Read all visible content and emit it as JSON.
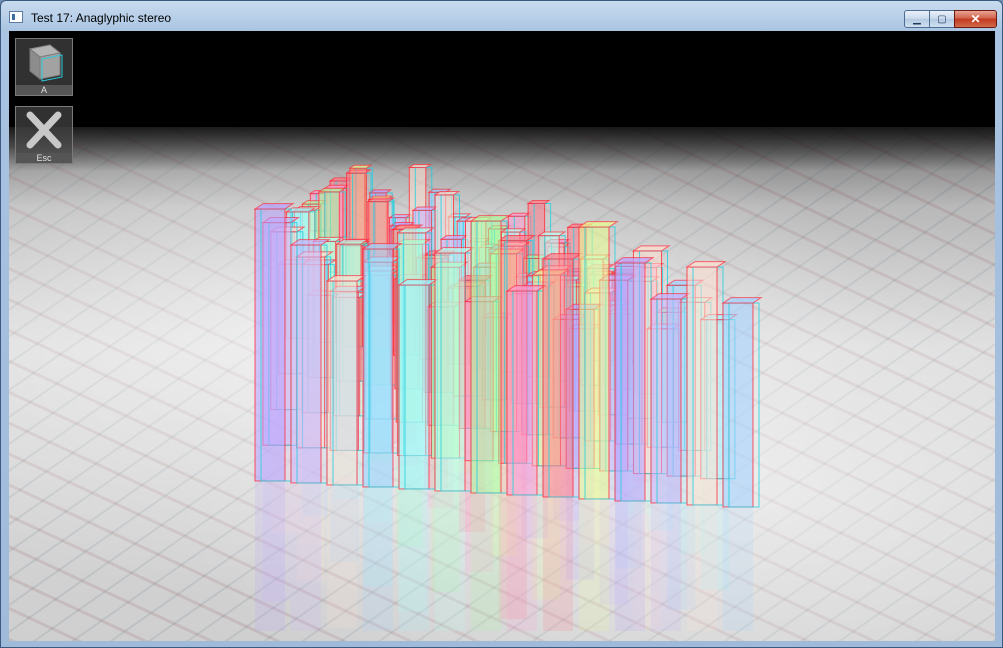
{
  "window": {
    "title": "Test 17: Anaglyphic stereo",
    "controls": {
      "minimize": "▁",
      "maximize": "▢",
      "close": "✕"
    }
  },
  "toolbar": {
    "buttons": [
      {
        "key": "A",
        "icon": "cube-icon"
      },
      {
        "key": "Esc",
        "icon": "close-x-icon"
      }
    ]
  },
  "scene": {
    "bar_palette": [
      "#ff9ad2",
      "#b7a0ff",
      "#9fd0ff",
      "#a8ff9e",
      "#e8ff8e",
      "#ffe0d0",
      "#b8ffee",
      "#ff7a8a",
      "#c9b0ff",
      "#9ef6ff"
    ],
    "anaglyph_colors": {
      "left": "#ff2a3a",
      "right": "#1ecfe0"
    }
  }
}
